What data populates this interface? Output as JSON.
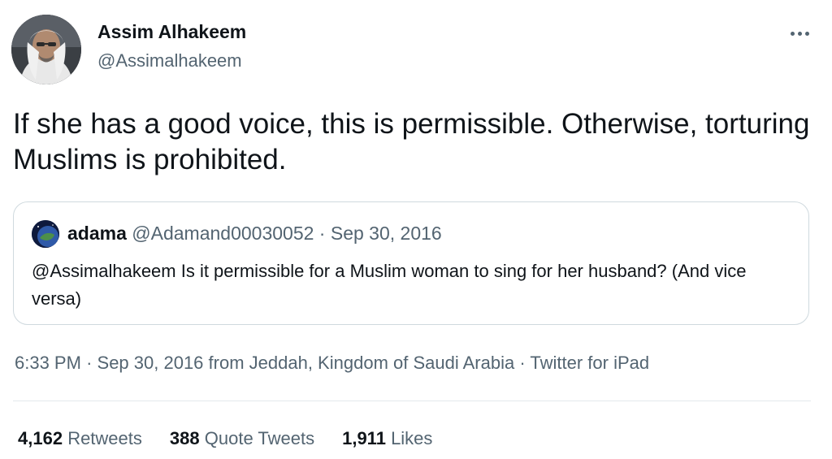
{
  "author": {
    "name": "Assim Alhakeem",
    "handle": "@Assimalhakeem"
  },
  "tweet": {
    "text": "If she has a good voice, this is permissible. Otherwise, torturing Muslims is prohibited."
  },
  "quoted_tweet": {
    "name": "adama",
    "handle": "@Adamand00030052",
    "separator": "·",
    "date": "Sep 30, 2016",
    "text": "@Assimalhakeem Is it permissible for a Muslim woman to sing for her husband? (And vice versa)"
  },
  "meta": {
    "time": "6:33 PM",
    "separator": "·",
    "date": "Sep 30, 2016",
    "location": "from Jeddah, Kingdom of Saudi Arabia",
    "separator2": "·",
    "source": "Twitter for iPad"
  },
  "stats": {
    "retweets": {
      "count": "4,162",
      "label": "Retweets"
    },
    "quote_tweets": {
      "count": "388",
      "label": "Quote Tweets"
    },
    "likes": {
      "count": "1,911",
      "label": "Likes"
    }
  },
  "colors": {
    "text_primary": "#0f1419",
    "text_secondary": "#536471",
    "border": "#cfd9de"
  },
  "icons": {
    "more": "more-horizontal-icon"
  }
}
